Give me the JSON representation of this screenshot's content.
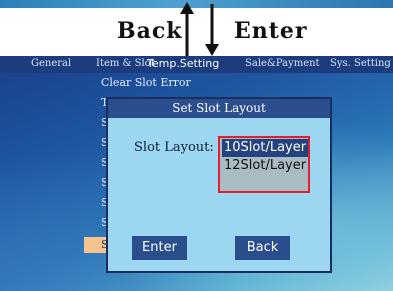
{
  "banner": {
    "back_label": "Back",
    "enter_label": "Enter"
  },
  "tabs": [
    {
      "label": "General"
    },
    {
      "label": "Item & Slot"
    },
    {
      "label": "Temp.Setting"
    },
    {
      "label": "Sale&Payment"
    },
    {
      "label": "Sys. Setting"
    }
  ],
  "menu": {
    "items": [
      {
        "label": "Clear Slot Error"
      },
      {
        "label": "T"
      },
      {
        "label": "S"
      },
      {
        "label": "S"
      },
      {
        "label": "S"
      },
      {
        "label": "S"
      },
      {
        "label": "S"
      },
      {
        "label": "S"
      },
      {
        "label": "S"
      }
    ],
    "selected_index": 8
  },
  "dialog": {
    "title": "Set Slot Layout",
    "field_label": "Slot Layout:",
    "options": [
      {
        "label": "10Slot/Layer",
        "selected": true
      },
      {
        "label": "12Slot/Layer",
        "selected": false
      }
    ],
    "enter_button": "Enter",
    "back_button": "Back"
  },
  "colors": {
    "dialog_bg": "#9dd6f0",
    "title_bar": "#2b4f8e",
    "highlight_border": "#e0202e",
    "selected_menu": "#f3c48e"
  }
}
